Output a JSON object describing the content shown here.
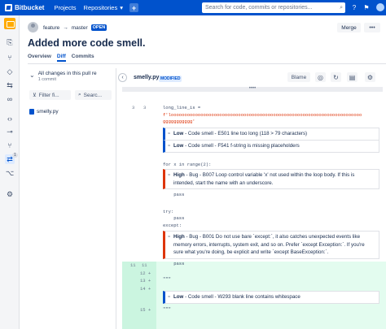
{
  "topbar": {
    "brand": "Bitbucket",
    "nav_projects": "Projects",
    "nav_repositories": "Repositories",
    "plus": "+",
    "search_placeholder": "Search for code, commits or repositories..."
  },
  "pr": {
    "source_branch": "feature",
    "target_branch": "master",
    "status": "OPEN",
    "title": "Added more code smell.",
    "merge_label": "Merge",
    "more_label": "•••"
  },
  "tabs": [
    "Overview",
    "Diff",
    "Commits"
  ],
  "tree": {
    "all_changes": "All changes in this pull re",
    "commit_count": "1 commit",
    "filter_label": "Filter fi...",
    "search_label": "Searc...",
    "file": "smelly.py"
  },
  "diff": {
    "file_name": "smelly.py",
    "badge": "MODIFIED",
    "blame_label": "Blame",
    "expand_label": "••••",
    "lines": [
      {
        "old": "3",
        "new": "3",
        "text": "long_line_is = "
      },
      {
        "old": "",
        "new": "",
        "text": "f'looooooooooooooooooooooooooooooooooooooooooooooooooooooooooooooooooooooo",
        "red": true
      },
      {
        "old": "",
        "new": "",
        "text": "ggggggggggg'",
        "red": true
      },
      {
        "old": "",
        "new": "",
        "text": "for x in range(2):"
      },
      {
        "old": "",
        "new": "",
        "text": "    pass"
      },
      {
        "old": "",
        "new": "",
        "text": "try:"
      },
      {
        "old": "",
        "new": "",
        "text": "    pass"
      },
      {
        "old": "",
        "new": "",
        "text": "except:"
      },
      {
        "old": "",
        "new": "",
        "text": "    pass"
      },
      {
        "old": "11",
        "new": "11",
        "text": ""
      },
      {
        "old": "",
        "new": "12 +",
        "text": ""
      },
      {
        "old": "",
        "new": "13 +",
        "text": "\"\"\""
      },
      {
        "old": "",
        "new": "14 +",
        "text": ""
      },
      {
        "old": "",
        "new": "15 +",
        "text": "\"\"\""
      }
    ],
    "comments": [
      {
        "severity": "Low",
        "type": "Code smell",
        "text": "E501 line too long (118 > 79 characters)"
      },
      {
        "severity": "Low",
        "type": "Code smell",
        "text": "F541 f-string is missing placeholders"
      },
      {
        "severity": "High",
        "type": "Bug",
        "text": "B007 Loop control variable 'x' not used within the loop body. If this is intended, start the name with an underscore."
      },
      {
        "severity": "High",
        "type": "Bug",
        "text": "B001 Do not use bare `except:`, it also catches unexpected events like memory errors, interrupts, system exit, and so on. Prefer `except Exception:`. If you're sure what you're doing, be explicit and write `except BaseException:`."
      },
      {
        "severity": "Low",
        "type": "Code smell",
        "text": "W293 blank line contains whitespace"
      }
    ]
  },
  "rail": {
    "badge": "1"
  },
  "colors": {
    "primary": "#0052cc",
    "open": "#0052cc",
    "added": "#e3fcef",
    "high": "#de350b",
    "low": "#ffc400"
  }
}
